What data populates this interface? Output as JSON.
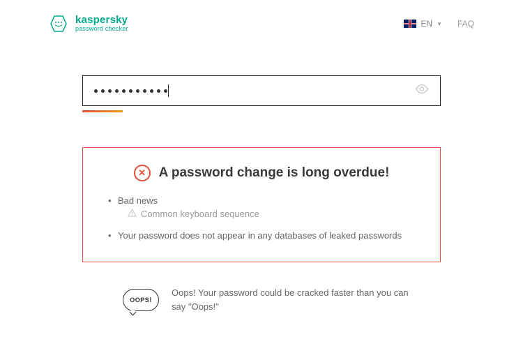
{
  "header": {
    "brand": "kaspersky",
    "subtitle": "password checker",
    "language_code": "EN",
    "faq_label": "FAQ"
  },
  "password": {
    "masked_length": 11,
    "strength_label": "weak",
    "strength_color_start": "#e74c3c",
    "strength_color_end": "#f39c12"
  },
  "result": {
    "title": "A password change is long overdue!",
    "items": [
      {
        "text": "Bad news",
        "sub": "Common keyboard sequence"
      },
      {
        "text": "Your password does not appear in any databases of leaked passwords"
      }
    ]
  },
  "oops": {
    "bubble": "OOPS!",
    "text": "Oops! Your password could be cracked faster than you can say \"Oops!\""
  }
}
